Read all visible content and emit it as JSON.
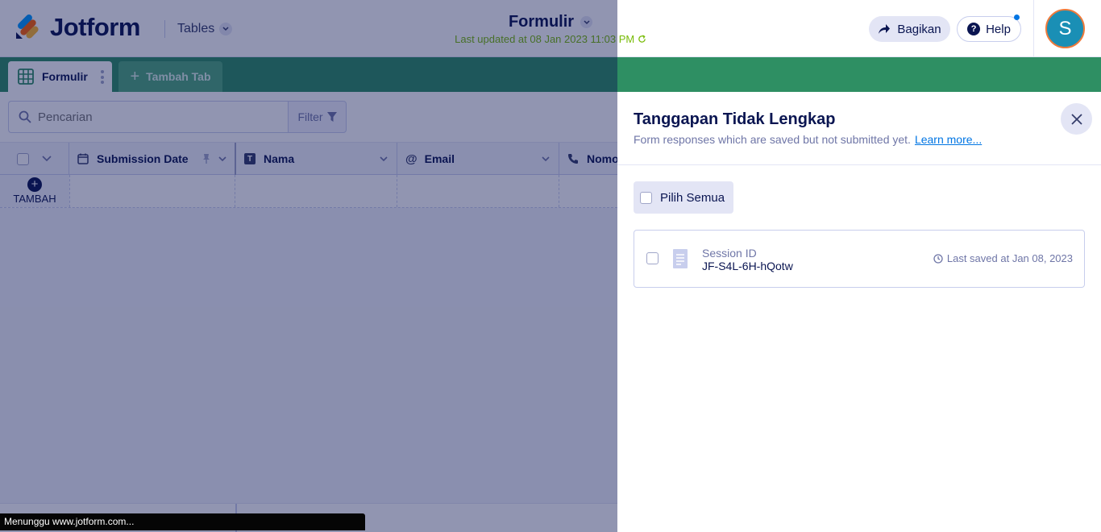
{
  "header": {
    "brand": "Jotform",
    "tables_label": "Tables",
    "form_title": "Formulir",
    "last_updated": "Last updated at 08 Jan 2023 11:03 PM",
    "share_label": "Bagikan",
    "help_label": "Help",
    "avatar_initial": "S"
  },
  "tabs": {
    "active_label": "Formulir",
    "add_label": "Tambah Tab"
  },
  "toolbar": {
    "search_placeholder": "Pencarian",
    "filter_label": "Filter"
  },
  "table": {
    "columns": [
      {
        "label": "Submission Date",
        "icon": "calendar-icon"
      },
      {
        "label": "Nama",
        "icon": "text-icon"
      },
      {
        "label": "Email",
        "icon": "at-icon"
      },
      {
        "label": "Nomo",
        "icon": "phone-icon"
      }
    ],
    "add_row_label": "TAMBAH"
  },
  "panel": {
    "title": "Tanggapan Tidak Lengkap",
    "subtitle": "Form responses which are saved but not submitted yet.",
    "learn_more": "Learn more...",
    "select_all_label": "Pilih Semua",
    "sessions": [
      {
        "label": "Session ID",
        "id": "JF-S4L-6H-hQotw",
        "last_saved": "Last saved at Jan 08, 2023"
      }
    ]
  },
  "status_bar": {
    "text": "Menunggu www.jotform.com..."
  },
  "colors": {
    "brand_green": "#2e8f63",
    "navy": "#0a1551",
    "update_green": "#78bb07",
    "link_blue": "#0075e3"
  }
}
